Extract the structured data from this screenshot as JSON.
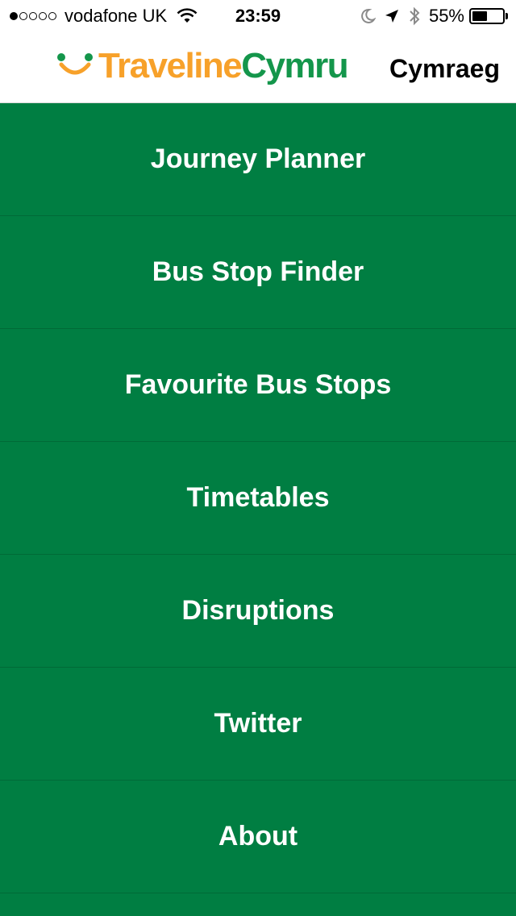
{
  "status_bar": {
    "carrier": "vodafone UK",
    "signal_bars": 1,
    "signal_total": 5,
    "time": "23:59",
    "battery_percent": "55%",
    "battery_level": 0.55
  },
  "header": {
    "logo_part1": "Traveline",
    "logo_part2": "Cymru",
    "language_toggle": "Cymraeg"
  },
  "menu": {
    "items": [
      {
        "label": "Journey Planner"
      },
      {
        "label": "Bus Stop Finder"
      },
      {
        "label": "Favourite Bus Stops"
      },
      {
        "label": "Timetables"
      },
      {
        "label": "Disruptions"
      },
      {
        "label": "Twitter"
      },
      {
        "label": "About"
      }
    ]
  },
  "colors": {
    "menu_background": "#007e42",
    "logo_orange": "#f7a12a",
    "logo_green": "#14964b",
    "divider": "#006a37"
  }
}
